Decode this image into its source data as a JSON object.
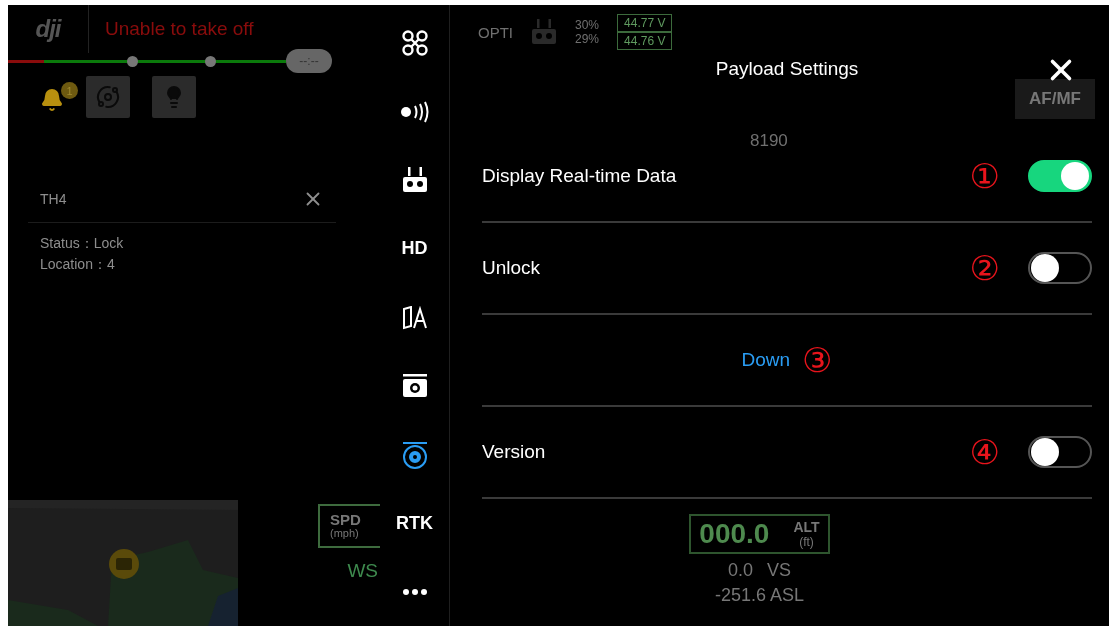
{
  "flight_status": {
    "brand": "dji",
    "message": "Unable to take off",
    "battery_time": "--:--",
    "level": 0.13
  },
  "notifications": {
    "count": "1"
  },
  "payload_card": {
    "title": "TH4",
    "lines": [
      "Status：Lock",
      "Location：4"
    ]
  },
  "telemetry_left": {
    "spd_label": "SPD",
    "spd_unit": "(mph)",
    "wind": "WS"
  },
  "side_rail": [
    {
      "kind": "drone",
      "selected": false
    },
    {
      "kind": "signal",
      "selected": false
    },
    {
      "kind": "remote",
      "selected": false
    },
    {
      "kind": "text",
      "label": "HD",
      "selected": false
    },
    {
      "kind": "map",
      "selected": false
    },
    {
      "kind": "camera",
      "selected": false
    },
    {
      "kind": "payload",
      "selected": true
    },
    {
      "kind": "text",
      "label": "RTK",
      "selected": false
    },
    {
      "kind": "more",
      "selected": false
    }
  ],
  "status_bar": {
    "mode": "OPTI",
    "battery_percent": [
      "30%",
      "29%"
    ],
    "voltages": [
      "44.77 V",
      "44.76 V"
    ]
  },
  "camera_controls": {
    "focus": "AF/MF",
    "count": "8190"
  },
  "altitude": {
    "value": "000.0",
    "label": "ALT",
    "unit": "(ft)",
    "vertical_speed": "0.0",
    "vs_label": "VS",
    "asl": "-251.6 ASL"
  },
  "panel": {
    "title": "Payload Settings",
    "settings": [
      {
        "kind": "toggle",
        "label": "Display Real-time Data",
        "on": true,
        "marker": "①"
      },
      {
        "kind": "toggle",
        "label": "Unlock",
        "on": false,
        "marker": "②"
      },
      {
        "kind": "action",
        "label": "Down",
        "marker": "③"
      },
      {
        "kind": "toggle",
        "label": "Version",
        "on": false,
        "marker": "④"
      }
    ]
  }
}
